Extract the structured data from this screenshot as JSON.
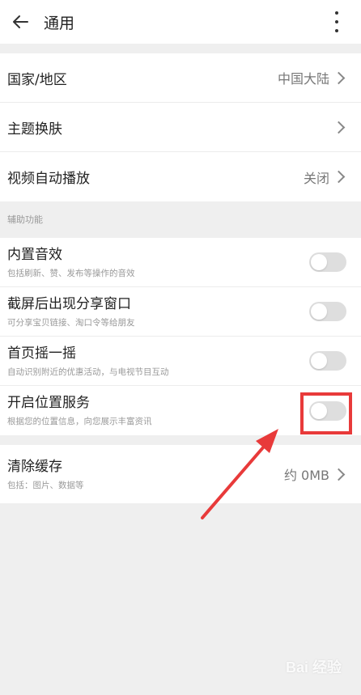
{
  "header": {
    "title": "通用",
    "back_icon": "arrow-left-icon",
    "more_icon": "more-vertical-icon"
  },
  "main_settings": [
    {
      "label": "国家/地区",
      "value": "中国大陆"
    },
    {
      "label": "主题换肤",
      "value": ""
    },
    {
      "label": "视频自动播放",
      "value": "关闭"
    }
  ],
  "accessibility": {
    "section_title": "辅助功能",
    "items": [
      {
        "title": "内置音效",
        "desc": "包括刷新、赞、发布等操作的音效",
        "on": false
      },
      {
        "title": "截屏后出现分享窗口",
        "desc": "可分享宝贝链接、淘口令等给朋友",
        "on": false
      },
      {
        "title": "首页摇一摇",
        "desc": "自动识别附近的优惠活动，与电视节目互动",
        "on": false
      },
      {
        "title": "开启位置服务",
        "desc": "根据您的位置信息，向您展示丰富资讯",
        "on": false
      }
    ]
  },
  "cache": {
    "title": "清除缓存",
    "desc": "包括：图片、数据等",
    "value": "约 0MB"
  },
  "watermark": "Bai 经验",
  "colors": {
    "highlight": "#e83a3a",
    "toggle_off": "#dedede",
    "background": "#efefef"
  }
}
